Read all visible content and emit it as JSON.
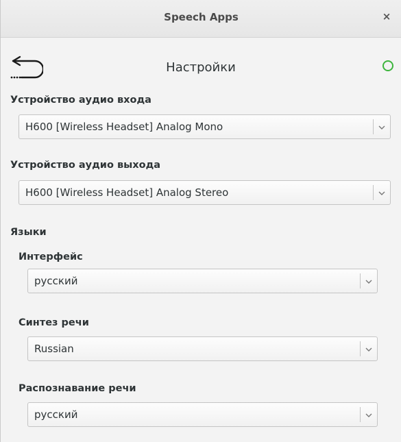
{
  "window": {
    "title": "Speech Apps",
    "close_glyph": "×"
  },
  "header": {
    "title": "Настройки",
    "back_icon": "back-arrow-icon",
    "status_icon": "status-circle-icon",
    "status_color": "#3cb43c"
  },
  "audio_input": {
    "label": "Устройство аудио входа",
    "value": "H600 [Wireless Headset] Analog Mono"
  },
  "audio_output": {
    "label": "Устройство аудио выхода",
    "value": "H600 [Wireless Headset] Analog Stereo"
  },
  "languages": {
    "label": "Языки",
    "interface": {
      "label": "Интерфейс",
      "value": "русский"
    },
    "synthesis": {
      "label": "Синтез речи",
      "value": "Russian"
    },
    "recognition": {
      "label": "Распознавание речи",
      "value": "русский"
    }
  }
}
